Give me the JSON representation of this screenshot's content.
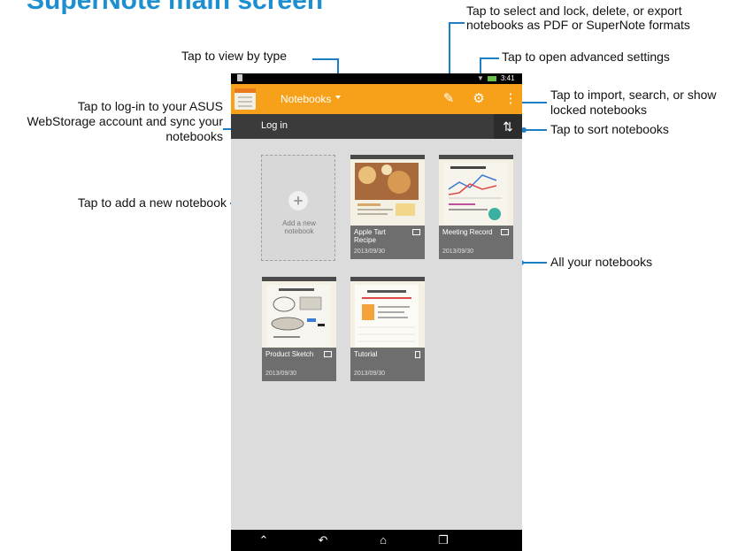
{
  "title": "SuperNote main screen",
  "callouts": {
    "view_by_type": "Tap to view by type",
    "select_lock": "Tap to select and lock, delete, or export\nnotebooks as PDF or SuperNote formats",
    "advanced_settings": "Tap to open advanced settings",
    "import_search": "Tap to import, search, or show\nlocked notebooks",
    "login": "Tap to log-in to your ASUS\nWebStorage account and sync your\nnotebooks",
    "sort": "Tap to sort notebooks",
    "add_notebook": "Tap to add a new notebook",
    "all_notebooks": "All your notebooks"
  },
  "status_bar": {
    "time": "3:41"
  },
  "action_bar": {
    "title": "Notebooks",
    "icons": [
      "app-icon",
      "edit-icon",
      "gear-icon",
      "overflow-icon"
    ]
  },
  "login_bar": {
    "label": "Log in",
    "sort_icon": "sort-icon"
  },
  "add_tile": {
    "label": "Add a new\nnotebook",
    "icon": "plus-icon"
  },
  "notebooks": [
    {
      "name": "Apple Tart Recipe",
      "date": "2013/09/30"
    },
    {
      "name": "Meeting Record",
      "date": "2013/09/30"
    },
    {
      "name": "Product Sketch",
      "date": "2013/09/30"
    },
    {
      "name": "Tutorial",
      "date": "2013/09/30"
    }
  ],
  "nav_bar": {
    "icons": [
      "recent-apps-up-icon",
      "back-icon",
      "home-icon",
      "recents-icon"
    ]
  },
  "colors": {
    "accent": "#1d7fc3",
    "action_bar": "#f7a11a",
    "title": "#1d8fd0"
  }
}
